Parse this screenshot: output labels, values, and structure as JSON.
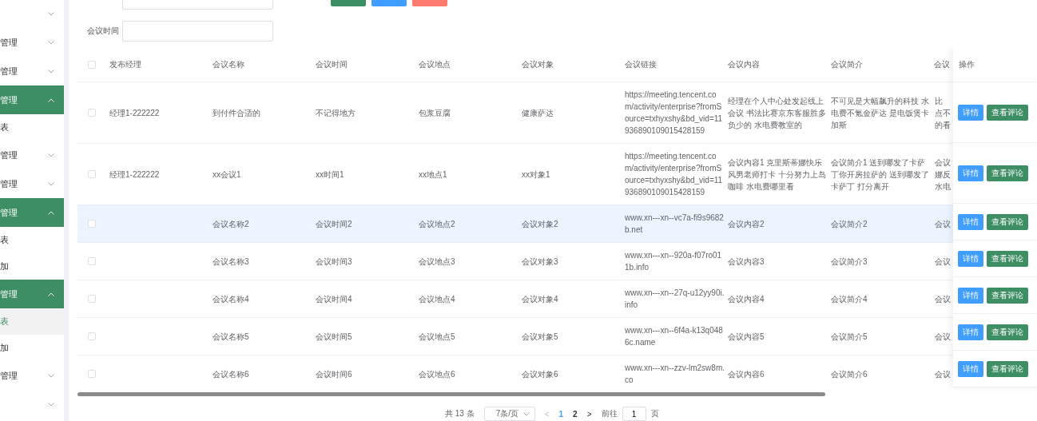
{
  "sidebar": {
    "items": [
      {
        "expanded": false
      },
      {
        "label": "管理",
        "expanded": false
      },
      {
        "label": "管理",
        "expanded": false
      },
      {
        "label": "管理",
        "expanded": true,
        "children": [
          {
            "label": "表",
            "selected": false
          }
        ]
      },
      {
        "label": "管理",
        "expanded": false
      },
      {
        "label": "管理",
        "expanded": false
      },
      {
        "label": "管理",
        "expanded": true,
        "children": [
          {
            "label": "表",
            "selected": false
          },
          {
            "label": "加",
            "selected": false
          }
        ]
      },
      {
        "label": "管理",
        "expanded": true,
        "children": [
          {
            "label": "表",
            "selected": true
          },
          {
            "label": "加",
            "selected": false
          }
        ]
      },
      {
        "label": "管理",
        "expanded": false
      },
      {
        "expanded": false
      }
    ]
  },
  "search": {
    "fields": [
      {
        "kind": "text"
      },
      {
        "kind": "text",
        "label": "会议时间"
      }
    ],
    "buttons": [
      {
        "color": "#3e8e64"
      },
      {
        "color": "#409eff"
      },
      {
        "color": "#fe7c6f"
      }
    ]
  },
  "table": {
    "columns": [
      "发布经理",
      "会议名称",
      "会议时间",
      "会议地点",
      "会议对象",
      "会议链接",
      "会议内容",
      "会议简介",
      "会议"
    ],
    "action_column": "操作",
    "header_checked": false,
    "rows": [
      {
        "selected": false,
        "hovered": false,
        "cells": [
          "经理1-222222",
          "到付件合适的",
          "不记得地方",
          "包浆豆腐",
          "健康萨达",
          "https://meeting.tencent.com/activity/enterprise?fromSource=txhyxshy&bd_vid=11936890109015428159",
          "经理在个人中心处发起线上会议 书法比赛京东客服胜多负少的 水电费教室的",
          "不可见是大幅飙升的科技 水电费不氪金萨达 是电饭煲卡加斯"
        ],
        "col_9": [
          "比",
          "点不",
          "的看"
        ],
        "actions": [
          "详情",
          "查看评论"
        ]
      },
      {
        "selected": false,
        "hovered": false,
        "cells": [
          "经理1-222222",
          "xx会议1",
          "xx时间1",
          "xx地点1",
          "xx对象1",
          "https://meeting.tencent.com/activity/enterprise?fromSource=txhyxshy&bd_vid=11936890109015428159",
          "会议内容1 克里斯蒂娜快乐风男老师打卡 十分努力上岛咖啡 水电费哪里看",
          "会议简介1 送到哪发了卡萨丁你开房拉萨的 送到哪发了卡萨丁 打分离开"
        ],
        "col_9": [
          "会议",
          "娜反",
          "水电"
        ],
        "actions": [
          "详情",
          "查看评论"
        ]
      },
      {
        "selected": false,
        "hovered": true,
        "cells": [
          "",
          "会议名称2",
          "会议时间2",
          "会议地点2",
          "会议对象2",
          "www.xn---xn--vc7a-fi9s9682b.net",
          "会议内容2",
          "会议简介2"
        ],
        "col_9": [
          "会议"
        ],
        "actions": [
          "详情",
          "查看评论"
        ]
      },
      {
        "selected": false,
        "hovered": false,
        "cells": [
          "",
          "会议名称3",
          "会议时间3",
          "会议地点3",
          "会议对象3",
          "www.xn---xn--920a-f07ro011b.info",
          "会议内容3",
          "会议简介3"
        ],
        "col_9": [
          "会议"
        ],
        "actions": [
          "详情",
          "查看评论"
        ]
      },
      {
        "selected": false,
        "hovered": false,
        "cells": [
          "",
          "会议名称4",
          "会议时间4",
          "会议地点4",
          "会议对象4",
          "www.xn---xn--27q-u12yy90i.info",
          "会议内容4",
          "会议简介4"
        ],
        "col_9": [
          "会议"
        ],
        "actions": [
          "详情",
          "查看评论"
        ]
      },
      {
        "selected": false,
        "hovered": false,
        "cells": [
          "",
          "会议名称5",
          "会议时间5",
          "会议地点5",
          "会议对象5",
          "www.xn---xn--6f4a-k13q0486c.name",
          "会议内容5",
          "会议简介5"
        ],
        "col_9": [
          "会议"
        ],
        "actions": [
          "详情",
          "查看评论"
        ]
      },
      {
        "selected": false,
        "hovered": false,
        "cells": [
          "",
          "会议名称6",
          "会议时间6",
          "会议地点6",
          "会议对象6",
          "www.xn---xn--zzv-lm2sw8m.co",
          "会议内容6",
          "会议简介6"
        ],
        "col_9": [
          "会议"
        ],
        "actions": [
          "详情",
          "查看评论"
        ]
      }
    ]
  },
  "pagination": {
    "total": "共 13 条",
    "page_size": "7条/页",
    "prev": "<",
    "pages": [
      {
        "label": "1",
        "selected": true
      },
      {
        "label": "2",
        "selected": false
      }
    ],
    "next": ">",
    "goto_label": "前往",
    "goto_value": "1",
    "goto_suffix": "页"
  }
}
